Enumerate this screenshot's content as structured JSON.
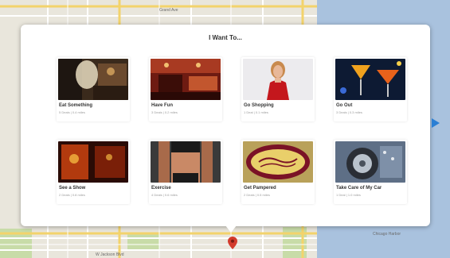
{
  "popup": {
    "title": "I Want To..."
  },
  "categories": [
    {
      "label": "Eat Something",
      "meta": "5 Deals | 0.4 miles"
    },
    {
      "label": "Have Fun",
      "meta": "3 Deals | 0.2 miles"
    },
    {
      "label": "Go Shopping",
      "meta": "1 Deal | 0.1 miles"
    },
    {
      "label": "Go Out",
      "meta": "3 Deals | 0.3 miles"
    },
    {
      "label": "See a Show",
      "meta": "2 Deals | 0.8 miles"
    },
    {
      "label": "Exercise",
      "meta": "4 Deals | 0.6 miles"
    },
    {
      "label": "Get Pampered",
      "meta": "2 Deals | 0.5 miles"
    },
    {
      "label": "Take Care of My Car",
      "meta": "1 Deal | 1.0 miles"
    }
  ],
  "map": {
    "street_labels": [
      "Grand Ave",
      "W Jackson Blvd",
      "Chicago Harbor"
    ]
  },
  "icons": {
    "next": "next-arrow-icon",
    "pin": "map-pin-icon"
  },
  "colors": {
    "accent": "#2a7fd4",
    "pin": "#d33b2c",
    "water": "#a5bfdd"
  }
}
